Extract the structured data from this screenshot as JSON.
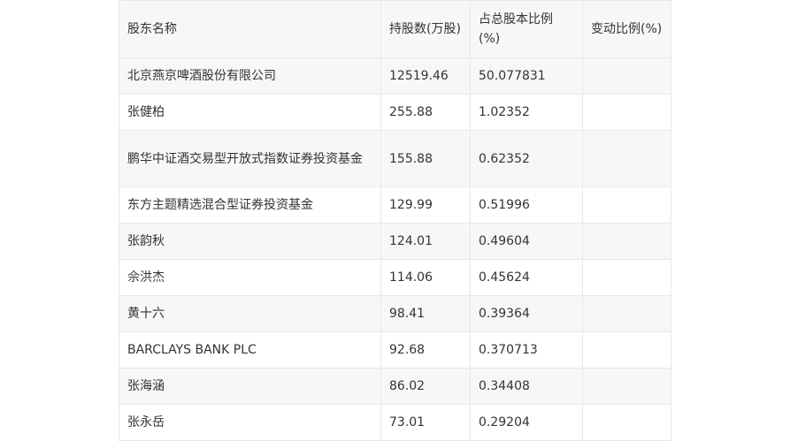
{
  "table": {
    "headers": [
      "股东名称",
      "持股数(万股)",
      "占总股本比例(%)",
      "变动比例(%)"
    ],
    "rows": [
      [
        "北京燕京啤酒股份有限公司",
        "12519.46",
        "50.077831",
        ""
      ],
      [
        "张健柏",
        "255.88",
        "1.02352",
        ""
      ],
      [
        "鹏华中证酒交易型开放式指数证券投资基金",
        "155.88",
        "0.62352",
        ""
      ],
      [
        "东方主题精选混合型证券投资基金",
        "129.99",
        "0.51996",
        ""
      ],
      [
        "张韵秋",
        "124.01",
        "0.49604",
        ""
      ],
      [
        "佘洪杰",
        "114.06",
        "0.45624",
        ""
      ],
      [
        "黄十六",
        "98.41",
        "0.39364",
        ""
      ],
      [
        "BARCLAYS BANK PLC",
        "92.68",
        "0.370713",
        ""
      ],
      [
        "张海涵",
        "86.02",
        "0.34408",
        ""
      ],
      [
        "张永岳",
        "73.01",
        "0.29204",
        ""
      ]
    ]
  }
}
